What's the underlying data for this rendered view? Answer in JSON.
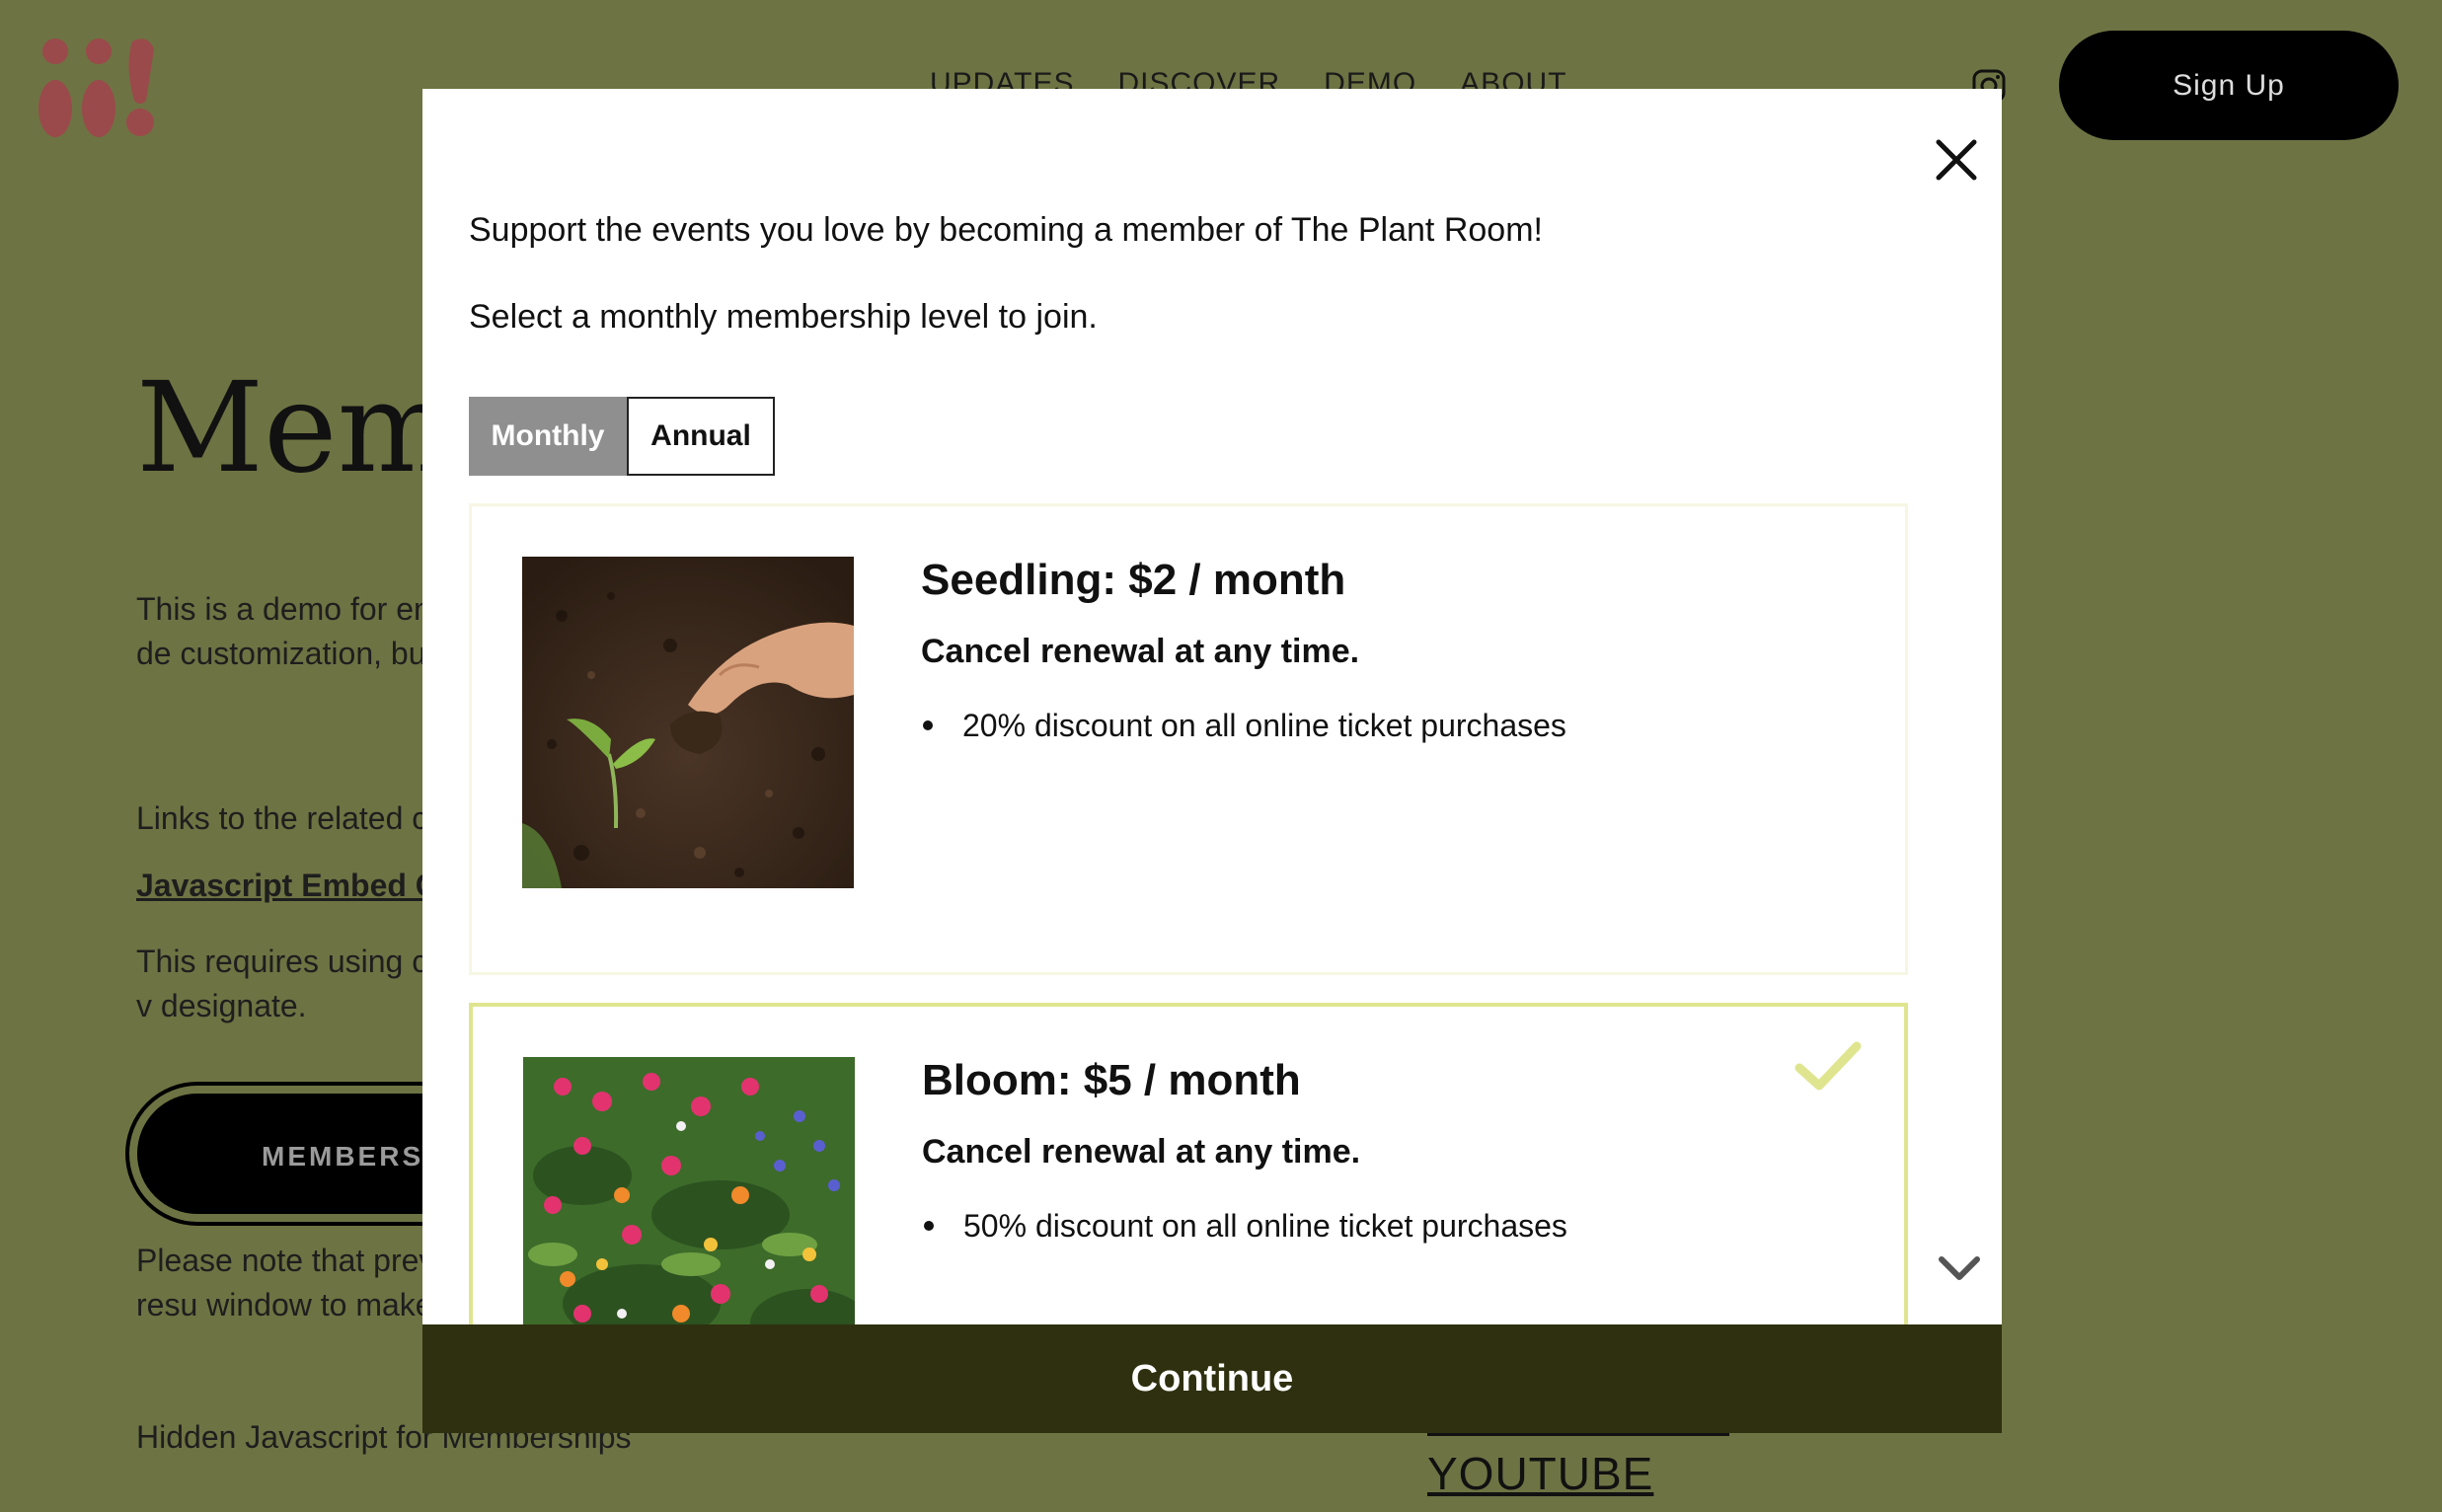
{
  "site": {
    "nav": [
      "UPDATES",
      "DISCOVER",
      "DEMO",
      "ABOUT"
    ],
    "signup_label": "Sign Up",
    "page_title": "Mem",
    "paragraph1": "This is a demo for en implemented, this de customization, but al setting up.",
    "paragraph2": "Links to the related c",
    "link_text": "Javascript Embed C",
    "paragraph3": "This requires using c on on your website, v designate.",
    "membership_button": "MEMBERSH",
    "paragraph4": "Please note that prev advised and will resu window to make sure session.",
    "paragraph5": "Hidden Javascript for Memberships",
    "footer_link": "YOUTUBE",
    "colors": {
      "background": "#6e7343",
      "logo": "#9a4a4a"
    }
  },
  "modal": {
    "intro": "Support the events you love by becoming a member of The Plant Room!",
    "instruction": "Select a monthly membership level to join.",
    "billing_options": [
      {
        "label": "Monthly",
        "selected": true
      },
      {
        "label": "Annual",
        "selected": false
      }
    ],
    "tiers": [
      {
        "name": "Seedling: $2 / month",
        "cancel_note": "Cancel renewal at any time.",
        "perk": "20% discount on all online ticket purchases",
        "image": "seedling-photo",
        "selected": false
      },
      {
        "name": "Bloom: $5 / month",
        "cancel_note": "Cancel renewal at any time.",
        "perk": "50% discount on all online ticket purchases",
        "image": "flower-bed-photo",
        "selected": true
      }
    ],
    "continue_label": "Continue",
    "colors": {
      "accent": "#dfe58f",
      "continue_bg": "#2f300f",
      "toggle_active": "#8f8f8f"
    }
  }
}
